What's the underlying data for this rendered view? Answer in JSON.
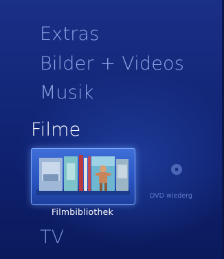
{
  "menu": {
    "items": [
      {
        "label": "Extras"
      },
      {
        "label": "Bilder + Videos"
      },
      {
        "label": "Musik"
      },
      {
        "label": "Filme"
      },
      {
        "label": "TV"
      }
    ],
    "selected": "Filme"
  },
  "filme": {
    "tiles": [
      {
        "label": "Filmbibliothek",
        "icon": "film-library-icon",
        "selected": true
      },
      {
        "label": "DVD wiederg",
        "icon": "dvd-disc-icon",
        "selected": false
      }
    ]
  },
  "colors": {
    "background": "#14287a",
    "menu_text": "#8da6e6",
    "selected_text": "#ffffff",
    "tile_accent": "#3f6fd8"
  }
}
